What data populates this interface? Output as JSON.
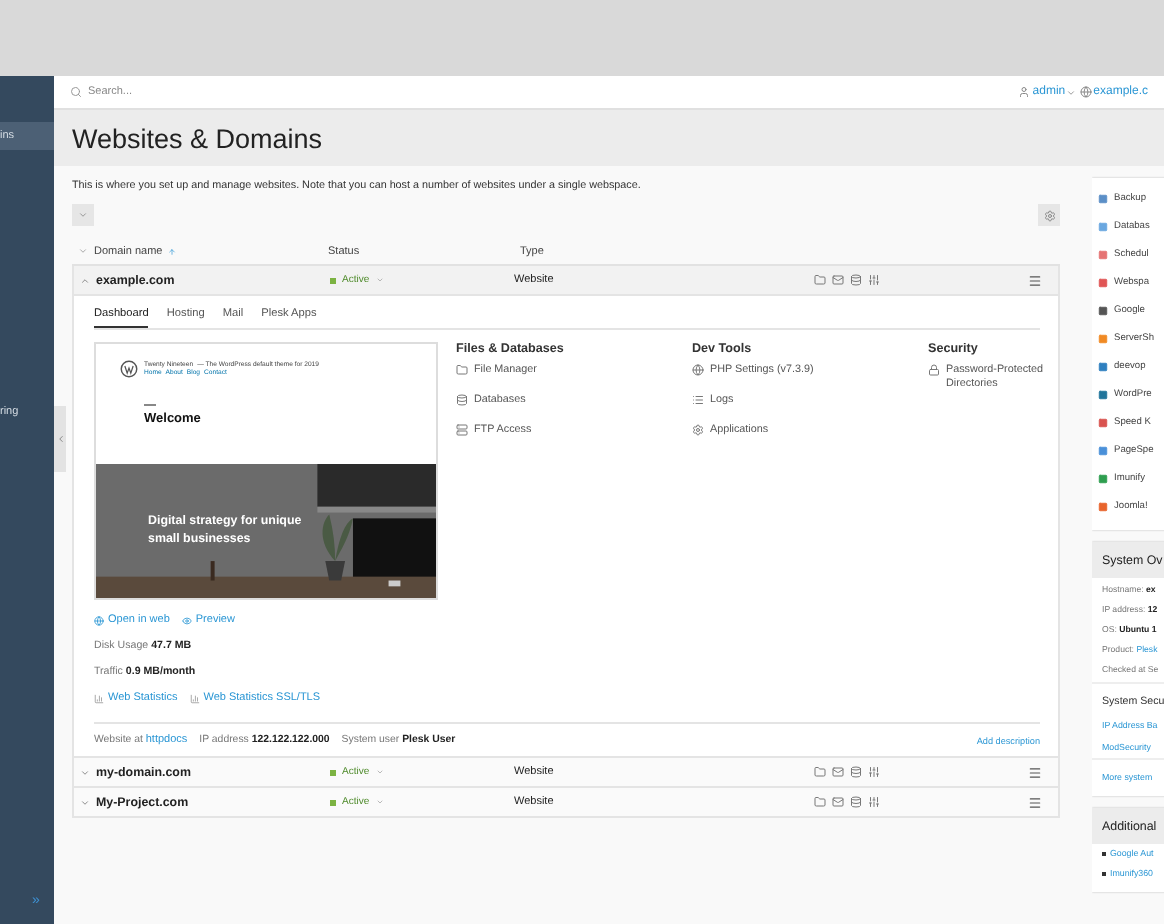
{
  "top_bar": {
    "search": {
      "placeholder": "Search..."
    },
    "user": "admin",
    "domain": "example.c"
  },
  "sidebar": {
    "items": [
      {
        "label": "ins",
        "selected": true
      },
      {
        "label": "ring",
        "selected": false
      }
    ],
    "collapse": "»"
  },
  "page": {
    "title": "Websites & Domains",
    "description": "This is where you set up and manage websites. Note that you can host a number of websites under a single webspace."
  },
  "table": {
    "columns": [
      "Domain name",
      "Status",
      "Type"
    ],
    "rows": [
      {
        "domain": "example.com",
        "status": "Active",
        "color": "#7cb342",
        "type": "Website",
        "expanded": true
      },
      {
        "domain": "my-domain.com",
        "status": "Active",
        "color": "#7cb342",
        "type": "Website",
        "expanded": false
      },
      {
        "domain": "My-Project.com",
        "status": "Active",
        "color": "#7cb342",
        "type": "Website",
        "expanded": false
      }
    ]
  },
  "dashboard": {
    "tabs": [
      {
        "label": "Dashboard",
        "selected": true
      },
      {
        "label": "Hosting",
        "selected": false
      },
      {
        "label": "Mail",
        "selected": false
      },
      {
        "label": "Plesk Apps",
        "selected": false
      }
    ],
    "preview": {
      "site_title": "Twenty Nineteen",
      "tagline": "— The WordPress default theme for 2019",
      "nav": [
        "Home",
        "About",
        "Blog",
        "Contact"
      ],
      "heading": "Welcome",
      "hero": "Digital strategy for unique small businesses"
    },
    "preview_links": [
      "Open in web",
      "Preview"
    ],
    "stats": [
      {
        "label": "Disk Usage",
        "value": "47.7 MB"
      },
      {
        "label": "Traffic",
        "value": "0.9 MB/month"
      }
    ],
    "stat_links": [
      "Web Statistics",
      "Web Statistics SSL/TLS"
    ],
    "sections": [
      {
        "title": "Files & Databases",
        "items": [
          {
            "label": "File Manager",
            "kind": "folder"
          },
          {
            "label": "Databases",
            "kind": "database"
          },
          {
            "label": "FTP Access",
            "kind": "server"
          }
        ]
      },
      {
        "title": "Dev Tools",
        "items": [
          {
            "label": "PHP Settings (v7.3.9)",
            "kind": "globe"
          },
          {
            "label": "Logs",
            "kind": "list"
          },
          {
            "label": "Applications",
            "kind": "gear"
          }
        ]
      },
      {
        "title": "Security",
        "items": [
          {
            "label": "Password-Protected Directories",
            "kind": "lock"
          }
        ]
      }
    ],
    "footer": {
      "website_at": "Website at",
      "docroot": "httpdocs",
      "ip_label": "IP address",
      "ip": "122.122.122.000",
      "user_label": "System user",
      "user": "Plesk User",
      "add_description": "Add description"
    }
  },
  "right_panel": {
    "apps": [
      {
        "label": "Backup",
        "color": "#5b8fc7"
      },
      {
        "label": "Databas",
        "color": "#6aa7e0"
      },
      {
        "label": "Schedul",
        "color": "#e57373"
      },
      {
        "label": "Webspa",
        "color": "#e05555"
      },
      {
        "label": "Google",
        "color": "#555555"
      },
      {
        "label": "ServerSh",
        "color": "#f08a24"
      },
      {
        "label": "deevop",
        "color": "#2e7fbf"
      },
      {
        "label": "WordPre",
        "color": "#21759b"
      },
      {
        "label": "Speed K",
        "color": "#d9534f"
      },
      {
        "label": "PageSpe",
        "color": "#4a90d9"
      },
      {
        "label": "Imunify",
        "color": "#2e9e4f"
      },
      {
        "label": "Joomla!",
        "color": "#e8642c"
      }
    ],
    "overview": {
      "title": "System Ov",
      "rows": [
        {
          "label": "Hostname:",
          "value": "ex"
        },
        {
          "label": "IP address:",
          "value": "12"
        },
        {
          "label": "OS:",
          "value": "Ubuntu 1"
        }
      ],
      "product_label": "Product:",
      "product": "Plesk",
      "checked": "Checked at Se"
    },
    "security": {
      "title": "System Secu",
      "links": [
        "IP Address Ba",
        "ModSecurity"
      ],
      "more": "More system"
    },
    "additional": {
      "title": "Additional",
      "links": [
        "Google Aut",
        "Imunify360"
      ]
    }
  }
}
